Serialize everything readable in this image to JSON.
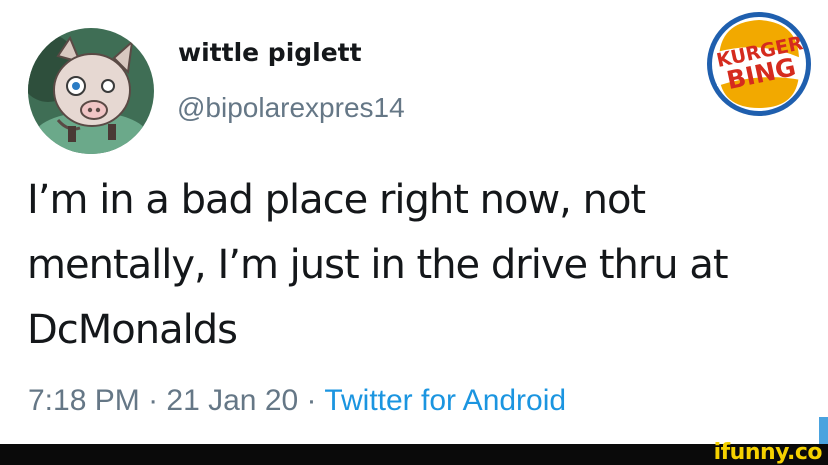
{
  "tweet": {
    "display_name": "wittle piglett",
    "handle": "@bipolarexpres14",
    "text": "I’m in a bad place right now, not\nmentally, I’m just in the drive thru at\nDcMonalds",
    "time": "7:18 PM",
    "separator": " · ",
    "date": "21 Jan 20",
    "source": "Twitter for Android"
  },
  "logo": {
    "line1": "KURGER",
    "line2": "BING"
  },
  "watermark": {
    "text": "ifunny.co"
  },
  "colors": {
    "name_text": "#14171a",
    "secondary_text": "#657786",
    "link_blue": "#1b95e0",
    "logo_red": "#d52b1e",
    "logo_orange": "#f2a900",
    "logo_blue": "#1f5fae",
    "watermark_yellow": "#f5d100"
  },
  "icons": {
    "avatar": "pig-avatar-icon",
    "logo": "burger-king-parody-logo-icon"
  }
}
